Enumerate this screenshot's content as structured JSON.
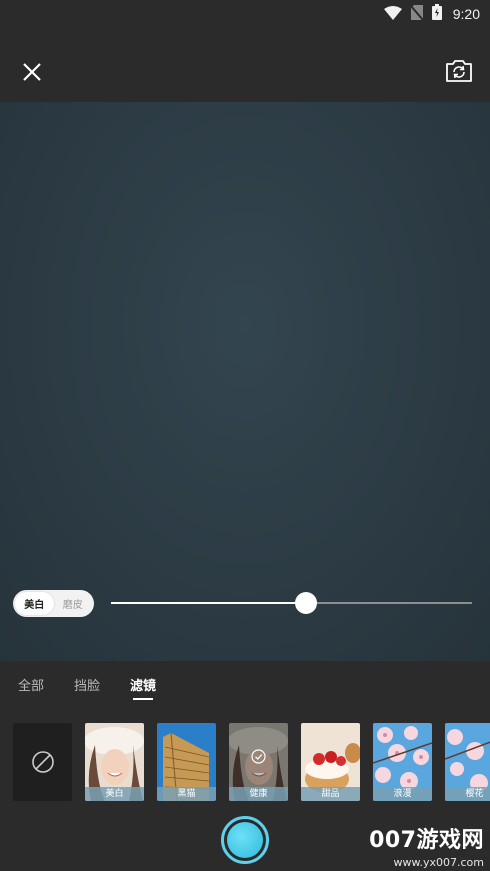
{
  "status_bar": {
    "time": "9:20",
    "icons": [
      "wifi-icon",
      "no-sim-icon",
      "battery-icon"
    ]
  },
  "top_bar": {
    "close_icon": "close-icon",
    "switch_icon": "camera-switch-icon"
  },
  "beauty": {
    "options": [
      "美白",
      "磨皮"
    ],
    "selected": "美白",
    "level": 0.54
  },
  "tabs": [
    {
      "label": "全部",
      "active": false
    },
    {
      "label": "挡脸",
      "active": false
    },
    {
      "label": "滤镜",
      "active": true
    }
  ],
  "filters": [
    {
      "label": "",
      "type": "none-icon",
      "selected": false
    },
    {
      "label": "美白",
      "type": "portrait",
      "selected": false
    },
    {
      "label": "黑猫",
      "type": "building",
      "selected": false
    },
    {
      "label": "健康",
      "type": "portrait-dim",
      "selected": true
    },
    {
      "label": "甜品",
      "type": "dessert",
      "selected": false
    },
    {
      "label": "浪漫",
      "type": "blossom",
      "selected": false
    },
    {
      "label": "樱花",
      "type": "blossom",
      "selected": false
    }
  ],
  "watermark": {
    "title": "007游戏网",
    "url": "www.yx007.com"
  },
  "colors": {
    "accent": "#4fc8e8",
    "background": "#2b2b2b",
    "preview": "#2d3c45"
  }
}
